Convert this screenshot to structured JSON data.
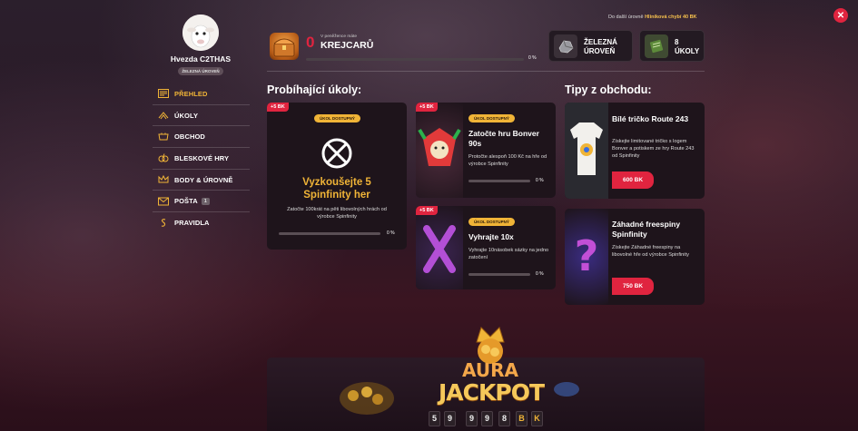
{
  "top": {
    "next_level_text": "Do další úrovně",
    "next_level_name": "Hliníková",
    "next_level_missing": "chybí 40 BK"
  },
  "profile": {
    "username": "Hvezda C2THAS",
    "level_badge": "ŽELEZNÁ ÚROVEŇ"
  },
  "nav": {
    "items": [
      {
        "label": "PŘEHLED",
        "icon": "overview-icon"
      },
      {
        "label": "ÚKOLY",
        "icon": "tasks-icon"
      },
      {
        "label": "OBCHOD",
        "icon": "shop-icon"
      },
      {
        "label": "BLESKOVÉ HRY",
        "icon": "flash-games-icon"
      },
      {
        "label": "BODY & ÚROVNĚ",
        "icon": "crown-icon"
      },
      {
        "label": "POŠTA",
        "icon": "mail-icon",
        "badge": "1"
      },
      {
        "label": "PRAVIDLA",
        "icon": "rules-icon"
      }
    ]
  },
  "wallet": {
    "amount": "0",
    "caption": "V peněžence máte",
    "unit": "KREJCARŮ",
    "progress_pct": "0 %",
    "progress_value": 0
  },
  "level_card": {
    "line1": "ŽELEZNÁ",
    "line2": "ÚROVEŇ"
  },
  "tasks_card": {
    "line1": "8",
    "line2": "ÚKOLY"
  },
  "sections": {
    "tasks_heading": "Probíhající úkoly:",
    "shop_heading": "Tipy z obchodu:"
  },
  "tasks": [
    {
      "reward": "+5 BK",
      "status": "ÚKOL DOSTUPNÝ",
      "title": "Vyzkoušejte 5 Spinfinity her",
      "desc": "Zatočte 100krát na pěti libovolných hrách od výrobce Spinfinity",
      "pct": "0 %",
      "progress": 0
    },
    {
      "reward": "+5 BK",
      "status": "ÚKOL DOSTUPNÝ",
      "title": "Zatočte hru Bonver 90s",
      "desc": "Protočte alespoň 100 Kč na hře od výrobce Spinfinity",
      "pct": "0 %",
      "progress": 0
    },
    {
      "reward": "+5 BK",
      "status": "ÚKOL DOSTUPNÝ",
      "title": "Vyhrajte 10x",
      "desc": "Vyhrajte 10násobek sázky na jedno zatočení",
      "pct": "0 %",
      "progress": 0
    }
  ],
  "shop": [
    {
      "title": "Bílé tričko Route 243",
      "desc": "Získejte limitované tričko s logem Bonver a potiskem ze hry Route 243 od Spinfinity",
      "price": "600 BK"
    },
    {
      "title": "Záhadné freespiny Spinfinity",
      "desc": "Získejte Záhadné freespiny na libovolné hře od výrobce Spinfinity",
      "price": "750 BK"
    }
  ],
  "jackpot": {
    "line1": "AURA",
    "line2": "JACKPOT",
    "digits": [
      "5",
      "9",
      "9",
      "9",
      "8",
      "B",
      "K"
    ]
  },
  "colors": {
    "accent_red": "#e0243f",
    "accent_gold": "#f0b437",
    "card_bg": "#1e141b"
  }
}
